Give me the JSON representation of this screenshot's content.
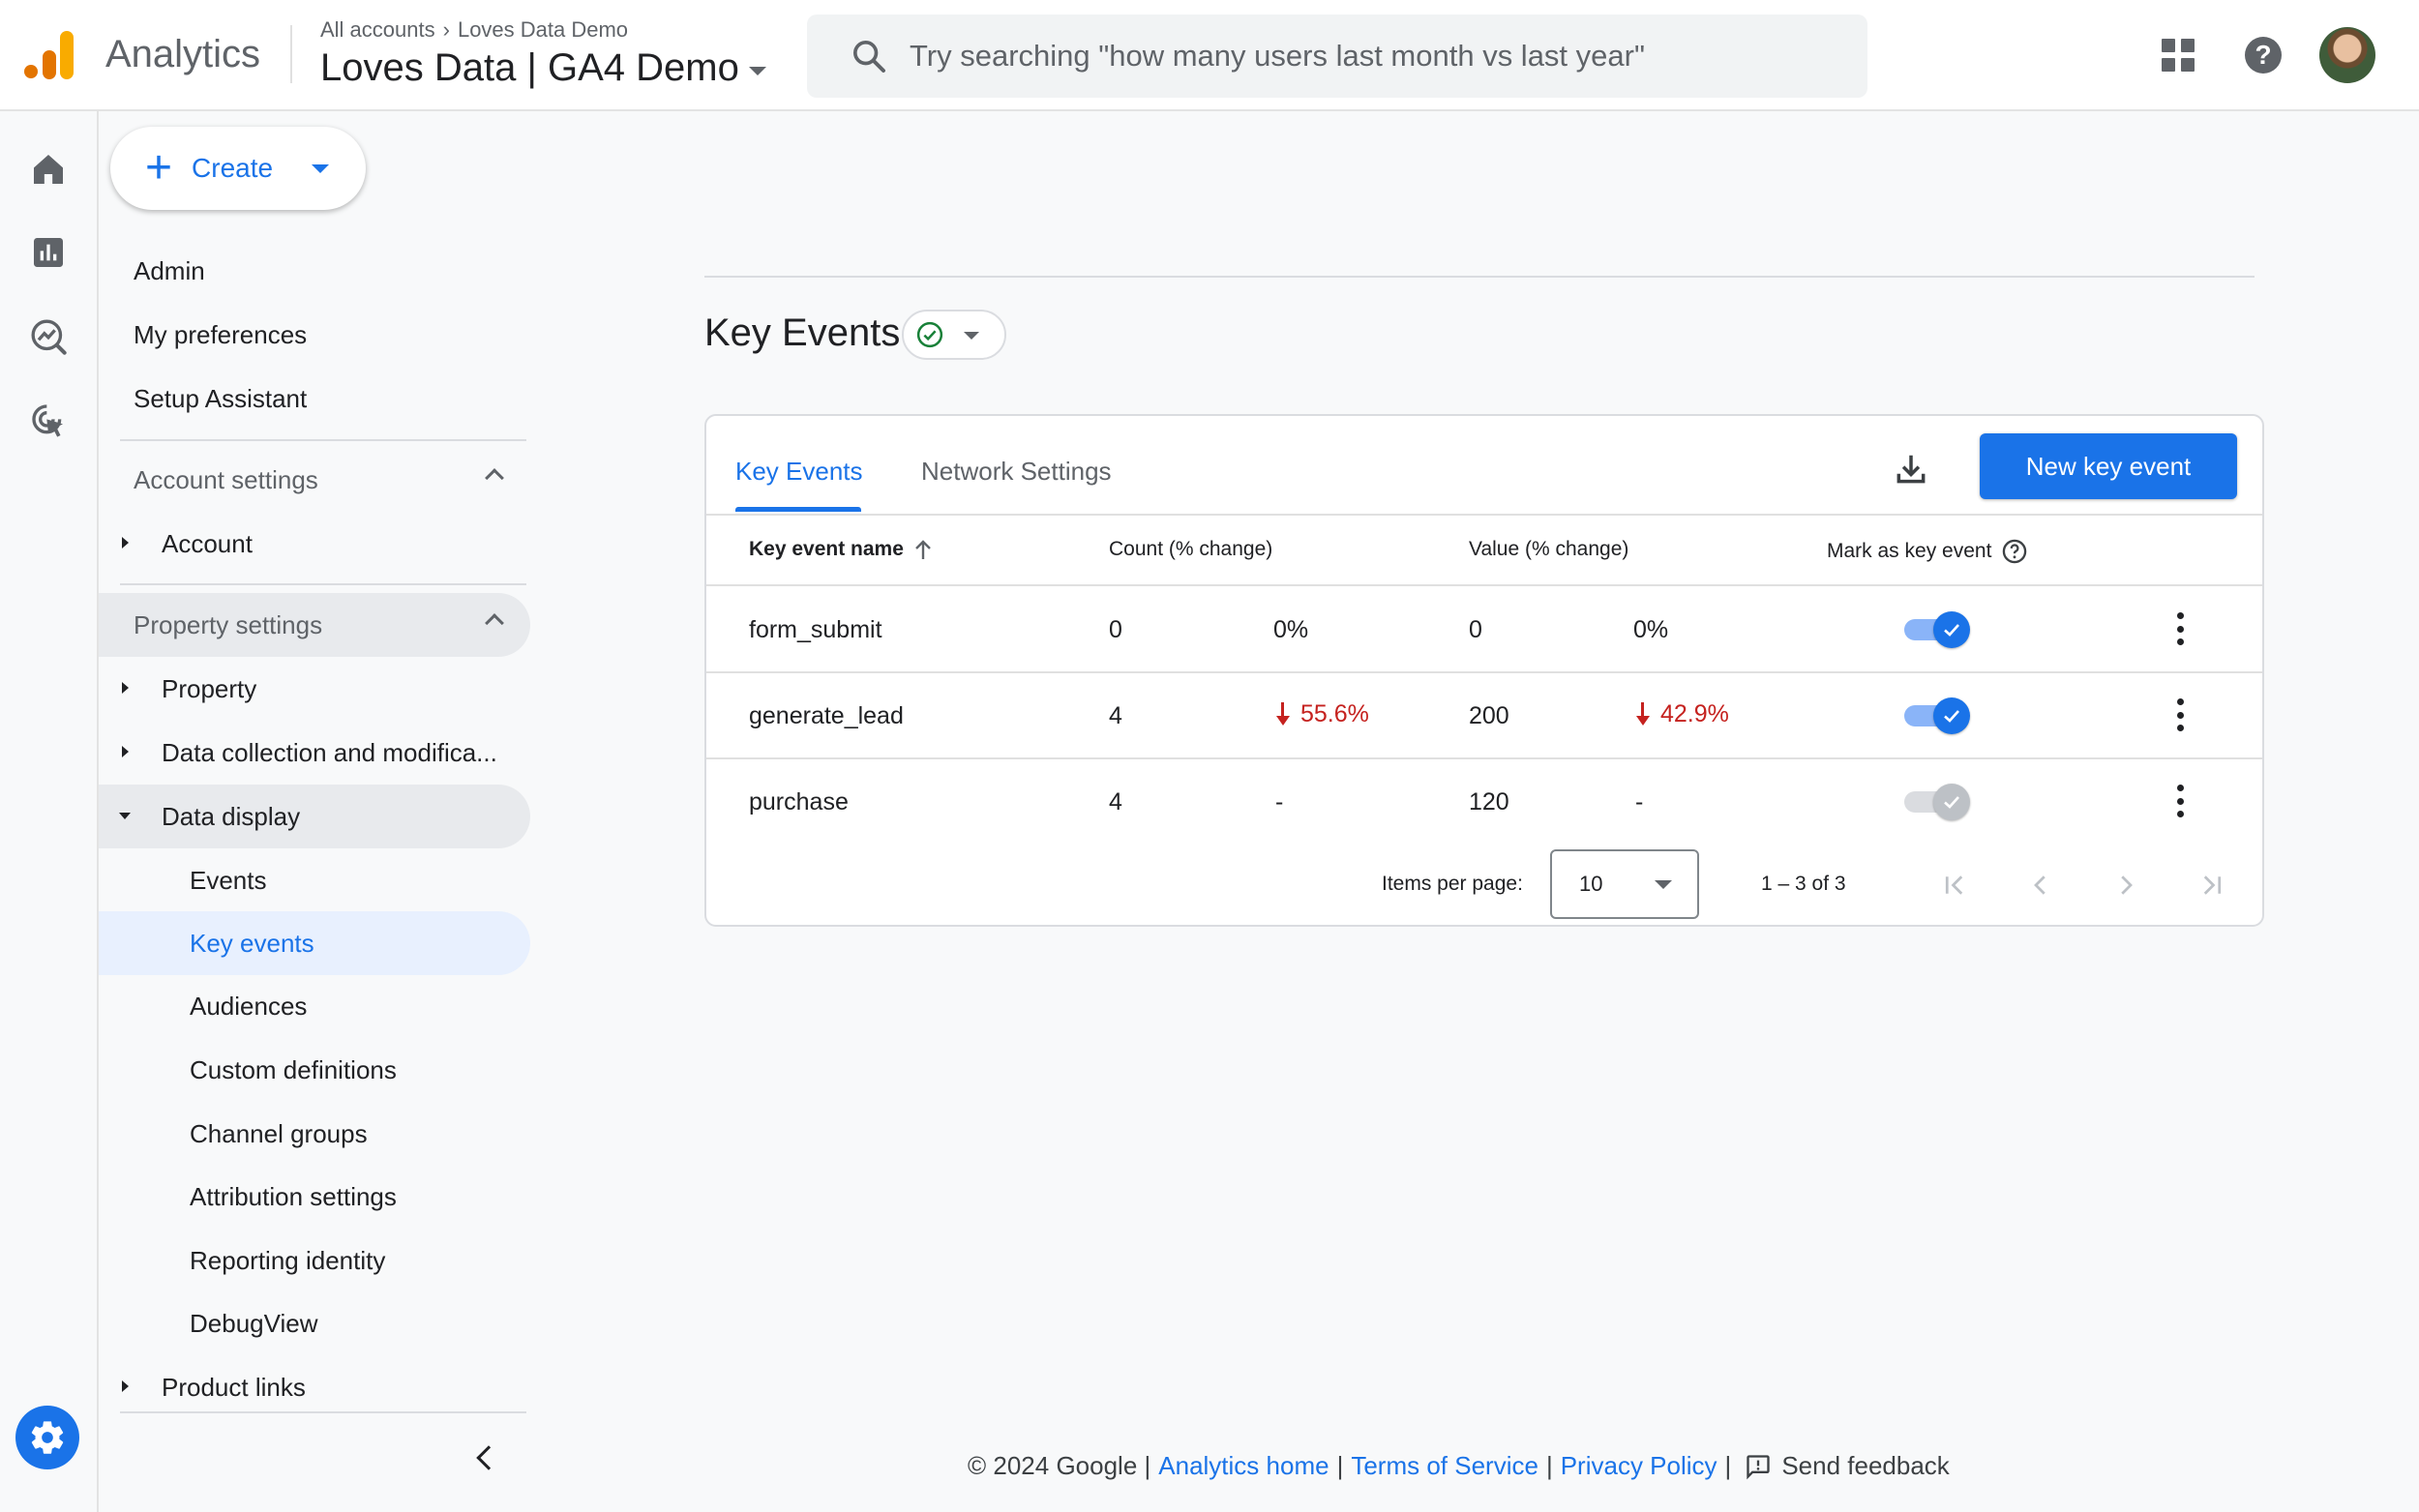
{
  "header": {
    "product_name": "Analytics",
    "breadcrumb": [
      "All accounts",
      "Loves Data Demo"
    ],
    "property_name": "Loves Data | GA4 Demo",
    "search_placeholder": "Try searching \"how many users last month vs last year\"",
    "brand_colors": {
      "logo_orange": "#f9ab00",
      "logo_dark": "#e37400"
    }
  },
  "rail": {
    "icons": [
      "home-icon",
      "reports-icon",
      "explore-icon",
      "advertising-icon"
    ],
    "settings_icon": "gear-icon"
  },
  "sidebar": {
    "create_label": "Create",
    "top_items": [
      "Admin",
      "My preferences",
      "Setup Assistant"
    ],
    "account_section": {
      "label": "Account settings",
      "items": [
        "Account"
      ]
    },
    "property_section": {
      "label": "Property settings",
      "items": [
        "Property",
        "Data collection and modifica...",
        "Data display"
      ],
      "data_display_children": [
        "Events",
        "Key events",
        "Audiences",
        "Custom definitions",
        "Channel groups",
        "Attribution settings",
        "Reporting identity",
        "DebugView"
      ],
      "after_items": [
        "Product links"
      ]
    },
    "active_item": "Key events"
  },
  "main": {
    "title": "Key Events",
    "tabs": [
      {
        "label": "Key Events",
        "active": true
      },
      {
        "label": "Network Settings",
        "active": false
      }
    ],
    "new_button_label": "New key event",
    "table": {
      "columns": [
        "Key event name",
        "Count (% change)",
        "Value (% change)",
        "Mark as key event"
      ],
      "rows": [
        {
          "name": "form_submit",
          "count": "0",
          "count_change": "0%",
          "count_down": false,
          "value": "0",
          "value_change": "0%",
          "value_down": false,
          "marked": true
        },
        {
          "name": "generate_lead",
          "count": "4",
          "count_change": "55.6%",
          "count_down": true,
          "value": "200",
          "value_change": "42.9%",
          "value_down": true,
          "marked": true
        },
        {
          "name": "purchase",
          "count": "4",
          "count_change": "-",
          "count_down": false,
          "value": "120",
          "value_change": "-",
          "value_down": false,
          "marked": false
        }
      ]
    },
    "pagination": {
      "label": "Items per page:",
      "page_size": "10",
      "range": "1 – 3 of 3"
    }
  },
  "footer": {
    "copyright": "© 2024 Google |",
    "links": [
      "Analytics home",
      "Terms of Service",
      "Privacy Policy"
    ],
    "feedback": "Send feedback"
  },
  "colors": {
    "accent": "#1a73e8",
    "negative": "#c5221f",
    "active_nav_bg": "#e8f0fe"
  }
}
